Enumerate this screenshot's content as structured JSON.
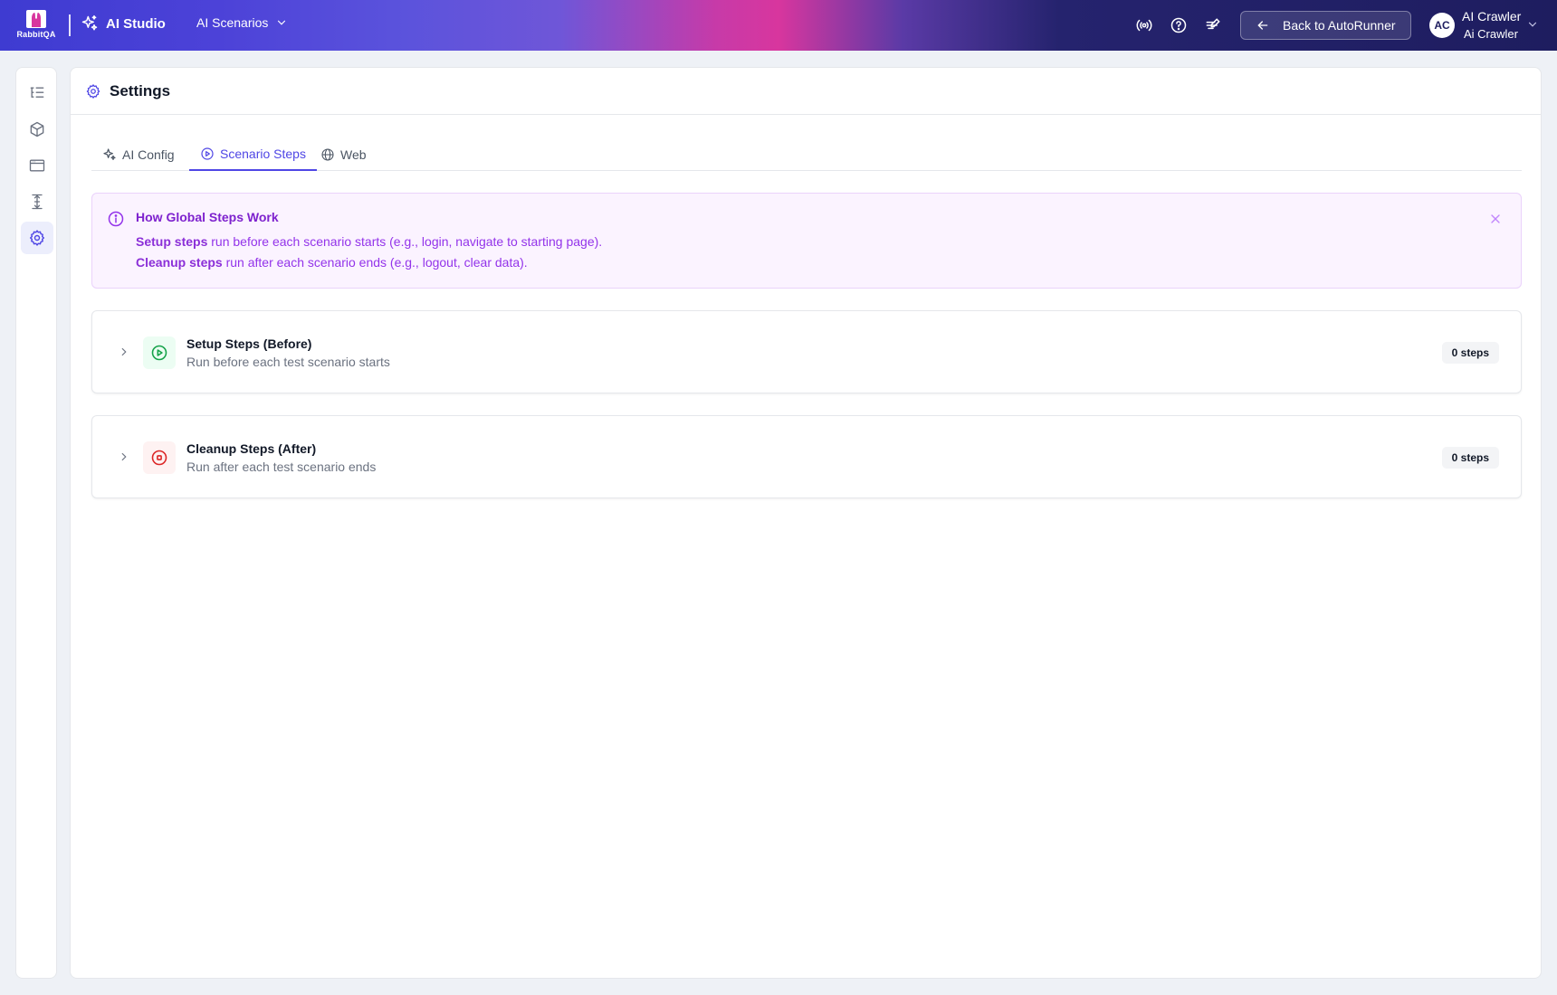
{
  "brand": {
    "logo_text": "RabbitQA",
    "studio_name": "AI Studio"
  },
  "nav": {
    "scenarios_label": "AI Scenarios"
  },
  "header_actions": {
    "back_label": "Back to AutoRunner"
  },
  "user": {
    "initials": "AC",
    "name": "AI Crawler",
    "subtitle": "Ai Crawler"
  },
  "rail": {
    "items": [
      {
        "icon": "list-tree-icon"
      },
      {
        "icon": "cube-icon"
      },
      {
        "icon": "browser-window-icon"
      },
      {
        "icon": "align-vertical-icon"
      },
      {
        "icon": "gear-icon",
        "active": true
      }
    ]
  },
  "page": {
    "title": "Settings"
  },
  "tabs": [
    {
      "label": "AI Config",
      "icon": "sparkles-icon"
    },
    {
      "label": "Scenario Steps",
      "icon": "play-circle-icon",
      "active": true
    },
    {
      "label": "Web",
      "icon": "globe-icon"
    }
  ],
  "info": {
    "title": "How Global Steps Work",
    "setup_bold": "Setup steps",
    "setup_text": " run before each scenario starts (e.g., login, navigate to starting page).",
    "cleanup_bold": "Cleanup steps",
    "cleanup_text": " run after each scenario ends (e.g., logout, clear data)."
  },
  "step_groups": [
    {
      "title": "Setup Steps (Before)",
      "subtitle": "Run before each test scenario starts",
      "count": "0 steps",
      "icon": "play-circle-icon",
      "color": "#16a34a"
    },
    {
      "title": "Cleanup Steps (After)",
      "subtitle": "Run after each test scenario ends",
      "count": "0 steps",
      "icon": "stop-circle-icon",
      "color": "#dc2626"
    }
  ],
  "colors": {
    "accent": "#4f46e5",
    "info_text": "#9333ea",
    "setup": "#16a34a",
    "cleanup": "#dc2626"
  }
}
